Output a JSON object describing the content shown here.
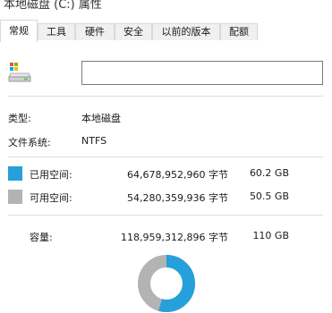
{
  "window": {
    "title": "本地磁盘 (C:) 属性"
  },
  "tabs": [
    {
      "label": "常规"
    },
    {
      "label": "工具"
    },
    {
      "label": "硬件"
    },
    {
      "label": "安全"
    },
    {
      "label": "以前的版本"
    },
    {
      "label": "配额"
    }
  ],
  "general": {
    "name_value": "",
    "type_label": "类型:",
    "type_value": "本地磁盘",
    "fs_label": "文件系统:",
    "fs_value": "NTFS",
    "used": {
      "label": "已用空间:",
      "bytes": "64,678,952,960 字节",
      "size": "60.2 GB",
      "color": "#26a0da"
    },
    "free": {
      "label": "可用空间:",
      "bytes": "54,280,359,936 字节",
      "size": "50.5 GB",
      "color": "#b3b3b3"
    },
    "capacity": {
      "label": "容量:",
      "bytes": "118,959,312,896 字节",
      "size": "110 GB"
    },
    "used_fraction": 0.544
  },
  "icons": {
    "drive": "drive-icon"
  }
}
